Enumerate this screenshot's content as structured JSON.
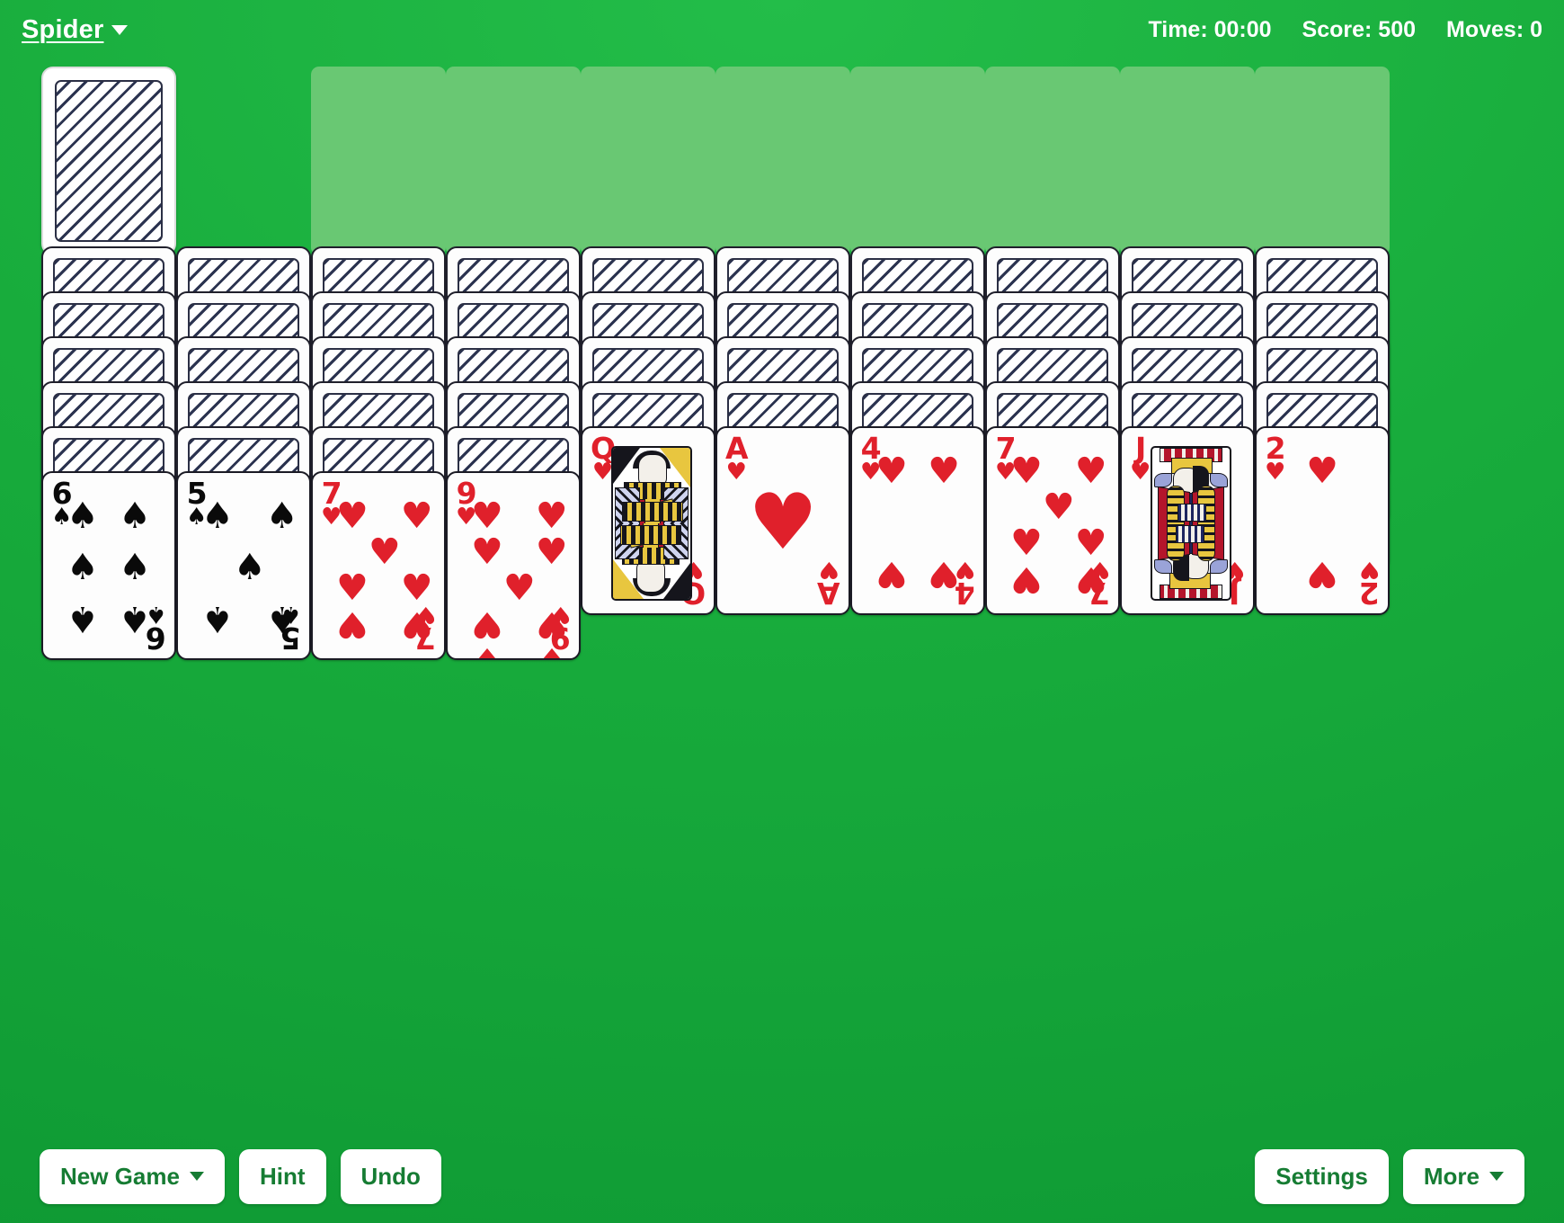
{
  "header": {
    "game_title": "Spider",
    "title_caret_icon": "chevron-down-icon",
    "time_label": "Time: 00:00",
    "score_label": "Score: 500",
    "moves_label": "Moves: 0"
  },
  "colors": {
    "table_green": "#18ac3c",
    "slot_green": "#69c873",
    "red_suit": "#e0202b",
    "black_suit": "#0a0a0a",
    "button_text": "#167c33",
    "card_white": "#fdfdfd",
    "card_back_stripe": "#2b3350"
  },
  "board": {
    "stock": {
      "name": "stock-pile",
      "card_back_count": 1
    },
    "foundations": [
      {
        "label": "foundation-1"
      },
      {
        "label": "foundation-2"
      },
      {
        "label": "foundation-3"
      },
      {
        "label": "foundation-4"
      },
      {
        "label": "foundation-5"
      },
      {
        "label": "foundation-6"
      },
      {
        "label": "foundation-7"
      },
      {
        "label": "foundation-8"
      }
    ],
    "tableau": [
      {
        "column": 1,
        "face_down": 5,
        "face_up": [
          {
            "rank": "6",
            "suit": "spades",
            "suit_glyph": "♠",
            "color": "black"
          }
        ]
      },
      {
        "column": 2,
        "face_down": 5,
        "face_up": [
          {
            "rank": "5",
            "suit": "spades",
            "suit_glyph": "♠",
            "color": "black"
          }
        ]
      },
      {
        "column": 3,
        "face_down": 5,
        "face_up": [
          {
            "rank": "7",
            "suit": "hearts",
            "suit_glyph": "♥",
            "color": "red"
          }
        ]
      },
      {
        "column": 4,
        "face_down": 5,
        "face_up": [
          {
            "rank": "9",
            "suit": "hearts",
            "suit_glyph": "♥",
            "color": "red"
          }
        ]
      },
      {
        "column": 5,
        "face_down": 4,
        "face_up": [
          {
            "rank": "Q",
            "suit": "hearts",
            "suit_glyph": "♥",
            "color": "red"
          }
        ]
      },
      {
        "column": 6,
        "face_down": 4,
        "face_up": [
          {
            "rank": "A",
            "suit": "hearts",
            "suit_glyph": "♥",
            "color": "red"
          }
        ]
      },
      {
        "column": 7,
        "face_down": 4,
        "face_up": [
          {
            "rank": "4",
            "suit": "hearts",
            "suit_glyph": "♥",
            "color": "red"
          }
        ]
      },
      {
        "column": 8,
        "face_down": 4,
        "face_up": [
          {
            "rank": "7",
            "suit": "hearts",
            "suit_glyph": "♥",
            "color": "red"
          }
        ]
      },
      {
        "column": 9,
        "face_down": 4,
        "face_up": [
          {
            "rank": "J",
            "suit": "hearts",
            "suit_glyph": "♥",
            "color": "red"
          }
        ]
      },
      {
        "column": 10,
        "face_down": 4,
        "face_up": [
          {
            "rank": "2",
            "suit": "hearts",
            "suit_glyph": "♥",
            "color": "red"
          }
        ]
      }
    ]
  },
  "toolbar": {
    "new_game_label": "New Game",
    "new_game_caret_icon": "chevron-down-icon",
    "hint_label": "Hint",
    "undo_label": "Undo",
    "settings_label": "Settings",
    "more_label": "More",
    "more_caret_icon": "chevron-down-icon"
  }
}
